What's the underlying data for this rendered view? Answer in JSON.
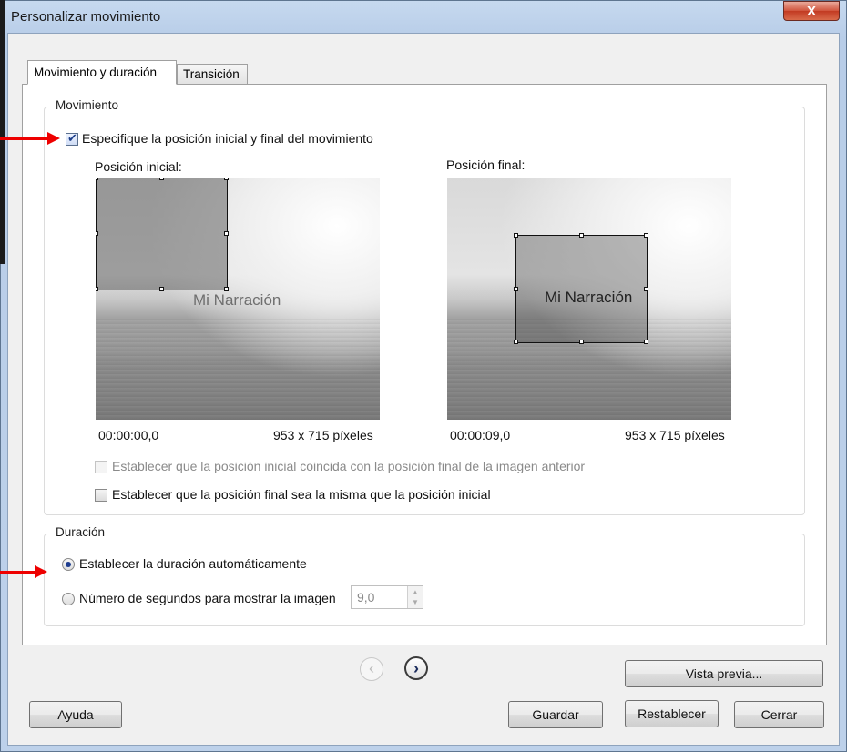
{
  "window": {
    "title": "Personalizar movimiento",
    "close_label": "X"
  },
  "tabs": [
    {
      "label": "Movimiento y duración",
      "active": true
    },
    {
      "label": "Transición",
      "active": false
    }
  ],
  "movement": {
    "group_label": "Movimiento",
    "specify_checkbox": {
      "label": "Especifique la posición inicial y final del movimiento",
      "checked": true
    },
    "start": {
      "label": "Posición inicial:",
      "time": "00:00:00,0",
      "size": "953 x 715 píxeles"
    },
    "end": {
      "label": "Posición final:",
      "time": "00:00:09,0",
      "size": "953 x 715 píxeles"
    },
    "watermark": "Mi Narración",
    "match_previous_checkbox": {
      "label": "Establecer que la posición inicial coincida con la posición final de la imagen anterior",
      "checked": false,
      "disabled": true
    },
    "same_position_checkbox": {
      "label": "Establecer que la posición final sea la misma que la posición inicial",
      "checked": false,
      "disabled": false
    }
  },
  "duration": {
    "group_label": "Duración",
    "auto_radio": {
      "label": "Establecer la duración automáticamente",
      "selected": true
    },
    "seconds_radio": {
      "label": "Número de segundos para mostrar la imagen",
      "selected": false
    },
    "seconds_value": "9,0"
  },
  "buttons": {
    "preview": "Vista previa...",
    "help": "Ayuda",
    "save": "Guardar",
    "reset": "Restablecer",
    "close": "Cerrar"
  },
  "nav": {
    "prev_icon": "chevron-left-icon",
    "next_icon": "chevron-right-icon"
  },
  "colors": {
    "annotation_arrow": "#e00000",
    "close_button": "#c8452d"
  }
}
